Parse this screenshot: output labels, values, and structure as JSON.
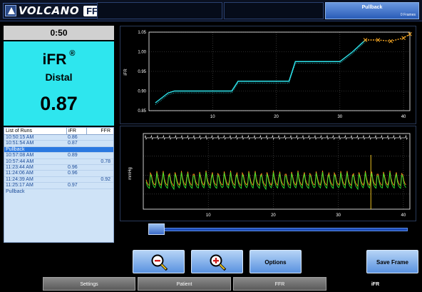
{
  "header": {
    "logo_text": "VOLCANO",
    "logo_badge": "FFR",
    "pullback_title": "Pullback",
    "pullback_frames": "0 Frames"
  },
  "timer": "0:50",
  "ifr_panel": {
    "title": "iFR",
    "mark": "®",
    "location": "Distal",
    "value": "0.87",
    "background": "#2ee6ee"
  },
  "runs": {
    "headers": [
      "List of Runs",
      "iFR",
      "FFR"
    ],
    "rows": [
      {
        "name": "10:50:15 AM",
        "ifr": "0.86",
        "ffr": ""
      },
      {
        "name": "10:51:54 AM",
        "ifr": "0.87",
        "ffr": ""
      },
      {
        "name": "Pullback",
        "ifr": "",
        "ffr": ""
      },
      {
        "name": "10:57:08 AM",
        "ifr": "0.89",
        "ffr": ""
      },
      {
        "name": "10:57:44 AM",
        "ifr": "",
        "ffr": "0.78"
      },
      {
        "name": "11:23:44 AM",
        "ifr": "0.96",
        "ffr": ""
      },
      {
        "name": "11:24:06 AM",
        "ifr": "0.96",
        "ffr": ""
      },
      {
        "name": "11:24:39 AM",
        "ifr": "",
        "ffr": "0.92"
      },
      {
        "name": "11:25:17 AM",
        "ifr": "0.97",
        "ffr": ""
      },
      {
        "name": "Pullback",
        "ifr": "",
        "ffr": ""
      }
    ]
  },
  "chart_data": [
    {
      "type": "line",
      "ylabel": "iFR",
      "ylim": [
        0.85,
        1.05
      ],
      "xlim": [
        0,
        41
      ],
      "yticks": [
        "0.85",
        "0.90",
        "0.95",
        "1.00",
        "1.05"
      ],
      "xticks": [
        "10",
        "20",
        "30",
        "40"
      ],
      "grid": true,
      "series": [
        {
          "color": "#2ee6ee",
          "x": [
            1,
            3,
            4,
            13,
            14,
            22,
            23,
            30,
            32,
            34
          ],
          "y": [
            0.87,
            0.895,
            0.9,
            0.9,
            0.925,
            0.925,
            0.975,
            0.975,
            1.0,
            1.03
          ]
        },
        {
          "color": "#f5a623",
          "x": [
            34,
            36,
            38,
            40,
            41
          ],
          "y": [
            1.03,
            1.03,
            1.027,
            1.035,
            1.045
          ]
        }
      ]
    },
    {
      "type": "line",
      "ylabel": "mmHg",
      "xlim": [
        0,
        41
      ],
      "xticks": [
        "10",
        "20",
        "30",
        "40"
      ],
      "grid": true,
      "series": [
        {
          "color": "#ff8c1a"
        },
        {
          "color": "#2ee62e"
        }
      ]
    }
  ],
  "buttons": {
    "zoom_out": "zoom-out",
    "zoom_in": "zoom-in",
    "options": "Options",
    "save_frame": "Save Frame"
  },
  "tabs": [
    "Settings",
    "Patient",
    "FFR",
    "iFR"
  ],
  "slider": {
    "value": 0.0
  }
}
